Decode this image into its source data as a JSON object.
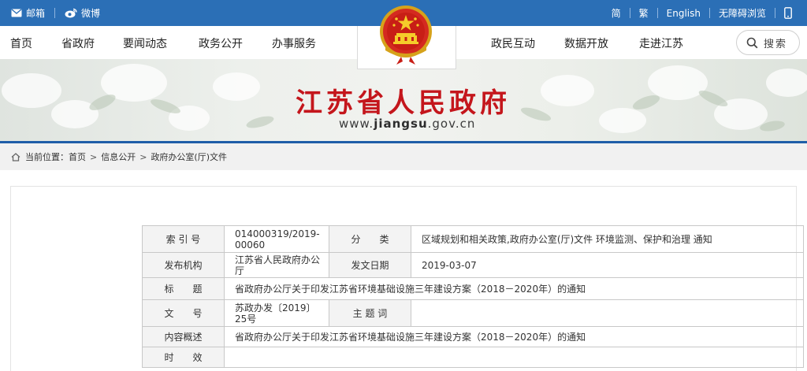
{
  "topbar": {
    "mail_label": "邮箱",
    "weibo_label": "微博",
    "simplified_label": "简",
    "traditional_label": "繁",
    "english_label": "English",
    "accessible_label": "无障碍浏览"
  },
  "nav": {
    "items_left": [
      "首页",
      "省政府",
      "要闻动态",
      "政务公开",
      "办事服务"
    ],
    "items_right": [
      "政民互动",
      "数据开放",
      "走进江苏"
    ],
    "search_label": "搜索"
  },
  "banner": {
    "title": "江苏省人民政府",
    "url_prefix": "www.",
    "url_domain": "jiangsu",
    "url_suffix": ".gov.cn"
  },
  "breadcrumb": {
    "prefix": "当前位置：",
    "items": [
      "首页",
      "信息公开",
      "政府办公室(厅)文件"
    ],
    "separator": ">"
  },
  "meta": {
    "index_label": "索 引 号",
    "index_value": "014000319/2019-00060",
    "category_label": "分　　类",
    "category_value": "区域规划和相关政策,政府办公室(厅)文件 环境监测、保护和治理 通知",
    "publisher_label": "发布机构",
    "publisher_value": "江苏省人民政府办公厅",
    "date_label": "发文日期",
    "date_value": "2019-03-07",
    "title_label": "标　　题",
    "title_value": "省政府办公厅关于印发江苏省环境基础设施三年建设方案（2018－2020年）的通知",
    "docnum_label": "文　　号",
    "docnum_value": "苏政办发〔2019〕25号",
    "keywords_label": "主 题 词",
    "keywords_value": "",
    "summary_label": "内容概述",
    "summary_value": "省政府办公厅关于印发江苏省环境基础设施三年建设方案（2018－2020年）的通知",
    "validity_label": "时　　效",
    "validity_value": ""
  },
  "colors": {
    "topbar_bg": "#2b6fb6",
    "title_red": "#c4161c",
    "banner_line": "#1f5ea8"
  }
}
